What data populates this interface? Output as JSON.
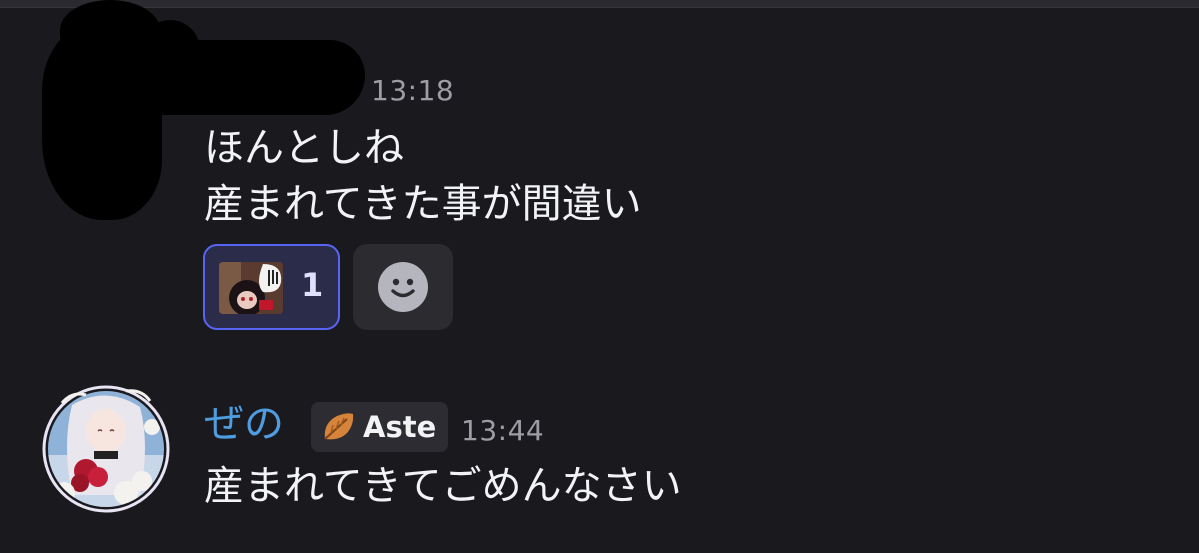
{
  "messages": [
    {
      "author": "",
      "author_redacted": true,
      "time": "13:18",
      "lines": [
        "ほんとしね",
        "産まれてきた事が間違い"
      ],
      "reactions": [
        {
          "type": "sticker-emoji",
          "count": "1",
          "active": true
        }
      ],
      "add_reaction_icon": "smile-icon"
    },
    {
      "author": "ぜの",
      "author_color": "#4f9de0",
      "tag": {
        "icon": "leaf-icon",
        "label": "Aste"
      },
      "time": "13:44",
      "lines": [
        "産まれてきてごめんなさい"
      ]
    }
  ],
  "colors": {
    "background": "#1a1a1e",
    "accent": "#5865f2"
  }
}
